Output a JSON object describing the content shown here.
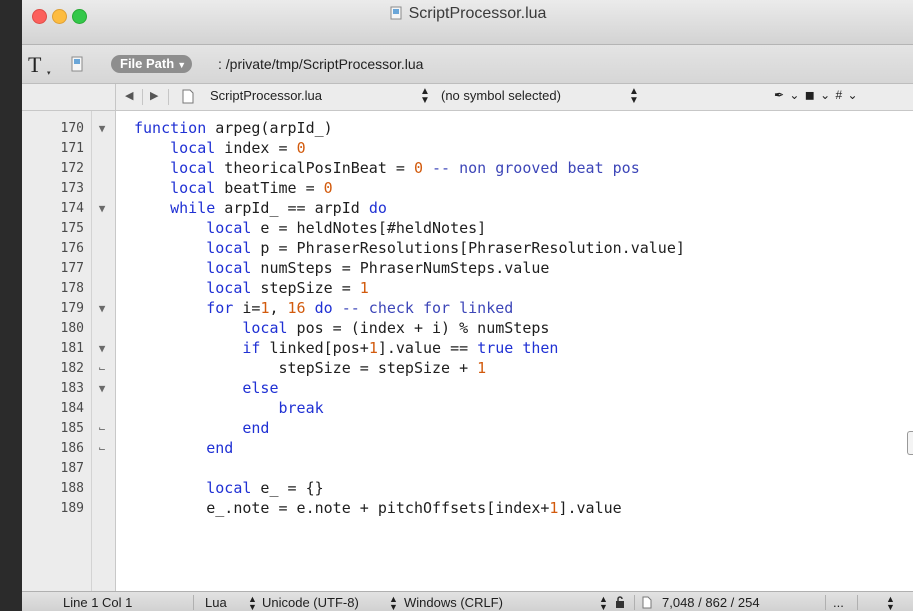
{
  "window": {
    "title": "ScriptProcessor.lua"
  },
  "pathbar": {
    "text_tool_glyph": "T",
    "file_path_button": "File Path",
    "path": ": /private/tmp/ScriptProcessor.lua"
  },
  "navbar": {
    "back_glyph": "◀",
    "forward_glyph": "▶",
    "file": "ScriptProcessor.lua",
    "symbol": "(no symbol selected)",
    "tools": "✒ ⌄ ◼ ⌄ # ⌄"
  },
  "editor": {
    "lines": [
      {
        "num": "170",
        "fold": "▼"
      },
      {
        "num": "171",
        "fold": ""
      },
      {
        "num": "172",
        "fold": ""
      },
      {
        "num": "173",
        "fold": ""
      },
      {
        "num": "174",
        "fold": "▼"
      },
      {
        "num": "175",
        "fold": ""
      },
      {
        "num": "176",
        "fold": ""
      },
      {
        "num": "177",
        "fold": ""
      },
      {
        "num": "178",
        "fold": ""
      },
      {
        "num": "179",
        "fold": "▼"
      },
      {
        "num": "180",
        "fold": ""
      },
      {
        "num": "181",
        "fold": "▼"
      },
      {
        "num": "182",
        "fold": "⌙"
      },
      {
        "num": "183",
        "fold": "▼"
      },
      {
        "num": "184",
        "fold": ""
      },
      {
        "num": "185",
        "fold": "⌙"
      },
      {
        "num": "186",
        "fold": "⌙"
      },
      {
        "num": "187",
        "fold": ""
      },
      {
        "num": "188",
        "fold": ""
      },
      {
        "num": "189",
        "fold": ""
      }
    ],
    "code": [
      [
        {
          "t": "function",
          "c": "kw"
        },
        {
          "t": " arpeg(arpId_)",
          "c": ""
        }
      ],
      [
        {
          "t": "    ",
          "c": ""
        },
        {
          "t": "local",
          "c": "kw"
        },
        {
          "t": " index = ",
          "c": ""
        },
        {
          "t": "0",
          "c": "num"
        }
      ],
      [
        {
          "t": "    ",
          "c": ""
        },
        {
          "t": "local",
          "c": "kw"
        },
        {
          "t": " theoricalPosInBeat = ",
          "c": ""
        },
        {
          "t": "0",
          "c": "num"
        },
        {
          "t": " -- non grooved beat pos",
          "c": "cmt"
        }
      ],
      [
        {
          "t": "    ",
          "c": ""
        },
        {
          "t": "local",
          "c": "kw"
        },
        {
          "t": " beatTime = ",
          "c": ""
        },
        {
          "t": "0",
          "c": "num"
        }
      ],
      [
        {
          "t": "    ",
          "c": ""
        },
        {
          "t": "while",
          "c": "kw"
        },
        {
          "t": " arpId_ == arpId ",
          "c": ""
        },
        {
          "t": "do",
          "c": "kw"
        }
      ],
      [
        {
          "t": "        ",
          "c": ""
        },
        {
          "t": "local",
          "c": "kw"
        },
        {
          "t": " e = heldNotes[#heldNotes]",
          "c": ""
        }
      ],
      [
        {
          "t": "        ",
          "c": ""
        },
        {
          "t": "local",
          "c": "kw"
        },
        {
          "t": " p = PhraserResolutions[PhraserResolution.value]",
          "c": ""
        }
      ],
      [
        {
          "t": "        ",
          "c": ""
        },
        {
          "t": "local",
          "c": "kw"
        },
        {
          "t": " numSteps = PhraserNumSteps.value",
          "c": ""
        }
      ],
      [
        {
          "t": "        ",
          "c": ""
        },
        {
          "t": "local",
          "c": "kw"
        },
        {
          "t": " stepSize = ",
          "c": ""
        },
        {
          "t": "1",
          "c": "num"
        }
      ],
      [
        {
          "t": "        ",
          "c": ""
        },
        {
          "t": "for",
          "c": "kw"
        },
        {
          "t": " i=",
          "c": ""
        },
        {
          "t": "1",
          "c": "num"
        },
        {
          "t": ", ",
          "c": ""
        },
        {
          "t": "16",
          "c": "num"
        },
        {
          "t": " ",
          "c": ""
        },
        {
          "t": "do",
          "c": "kw"
        },
        {
          "t": " -- check for linked",
          "c": "cmt"
        }
      ],
      [
        {
          "t": "            ",
          "c": ""
        },
        {
          "t": "local",
          "c": "kw"
        },
        {
          "t": " pos = (index + i) % numSteps",
          "c": ""
        }
      ],
      [
        {
          "t": "            ",
          "c": ""
        },
        {
          "t": "if",
          "c": "kw"
        },
        {
          "t": " linked[pos+",
          "c": ""
        },
        {
          "t": "1",
          "c": "num"
        },
        {
          "t": "].value == ",
          "c": ""
        },
        {
          "t": "true",
          "c": "kw"
        },
        {
          "t": " ",
          "c": ""
        },
        {
          "t": "then",
          "c": "kw"
        }
      ],
      [
        {
          "t": "                stepSize = stepSize + ",
          "c": ""
        },
        {
          "t": "1",
          "c": "num"
        }
      ],
      [
        {
          "t": "            ",
          "c": ""
        },
        {
          "t": "else",
          "c": "kw"
        }
      ],
      [
        {
          "t": "                ",
          "c": ""
        },
        {
          "t": "break",
          "c": "kw"
        }
      ],
      [
        {
          "t": "            ",
          "c": ""
        },
        {
          "t": "end",
          "c": "kw"
        }
      ],
      [
        {
          "t": "        ",
          "c": ""
        },
        {
          "t": "end",
          "c": "kw"
        }
      ],
      [
        {
          "t": "",
          "c": ""
        }
      ],
      [
        {
          "t": "        ",
          "c": ""
        },
        {
          "t": "local",
          "c": "kw"
        },
        {
          "t": " e_ = {}",
          "c": ""
        }
      ],
      [
        {
          "t": "        e_.note = e.note + pitchOffsets[index+",
          "c": ""
        },
        {
          "t": "1",
          "c": "num"
        },
        {
          "t": "].value",
          "c": ""
        }
      ]
    ]
  },
  "statusbar": {
    "position": "Line 1 Col 1",
    "language": "Lua",
    "encoding": "Unicode (UTF-8)",
    "line_endings": "Windows (CRLF)",
    "counts": "7,048 / 862 / 254",
    "more": "..."
  },
  "colors": {
    "keyword": "#2031d4",
    "number": "#d25a0c",
    "comment": "#3d46b8"
  }
}
